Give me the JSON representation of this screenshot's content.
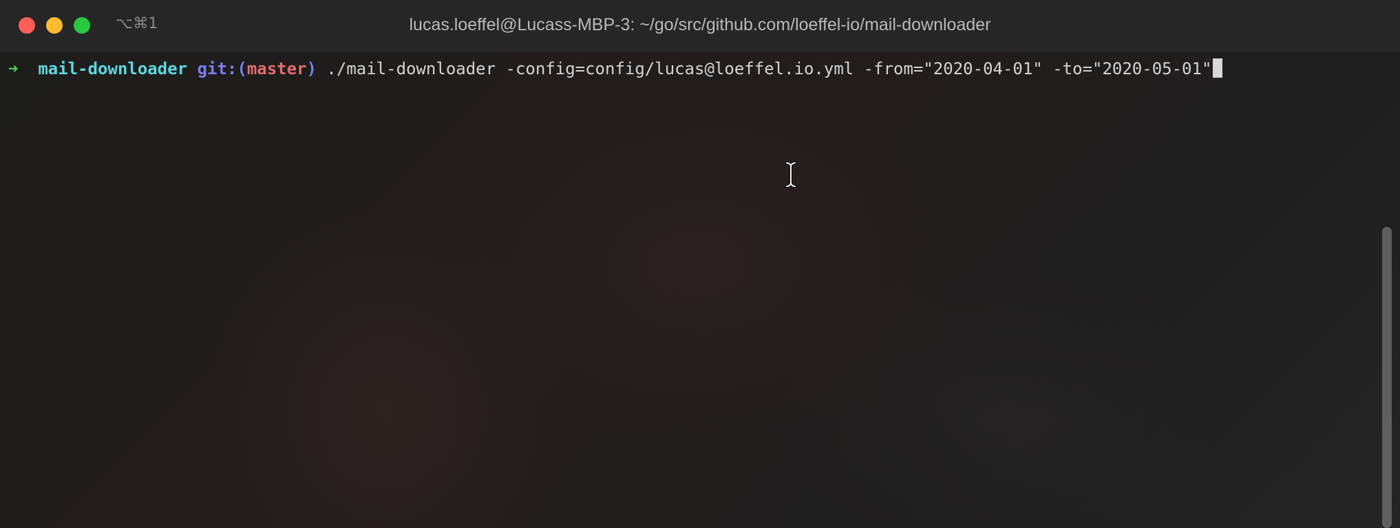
{
  "titlebar": {
    "shortcut": "⌥⌘1",
    "title": "lucas.loeffel@Lucass-MBP-3: ~/go/src/github.com/loeffel-io/mail-downloader",
    "buttons": [
      "close",
      "minimize",
      "zoom"
    ]
  },
  "terminal": {
    "prompt_arrow": "➜",
    "directory": "mail-downloader",
    "git_prefix": "git:(",
    "git_branch": "master",
    "git_suffix": ")",
    "command": "./mail-downloader -config=config/lucas@loeffel.io.yml -from=\"2020-04-01\" -to=\"2020-05-01\""
  },
  "icons": {
    "pointer": "text-cursor-ibeam-icon"
  },
  "colors": {
    "arrow": "#4fd14f",
    "directory": "#5fd7e0",
    "git": "#7a7df2",
    "branch": "#e36d6d",
    "text": "#d4d4d4",
    "close": "#ff5f57",
    "minimize": "#febc2e",
    "zoom": "#28c840"
  }
}
